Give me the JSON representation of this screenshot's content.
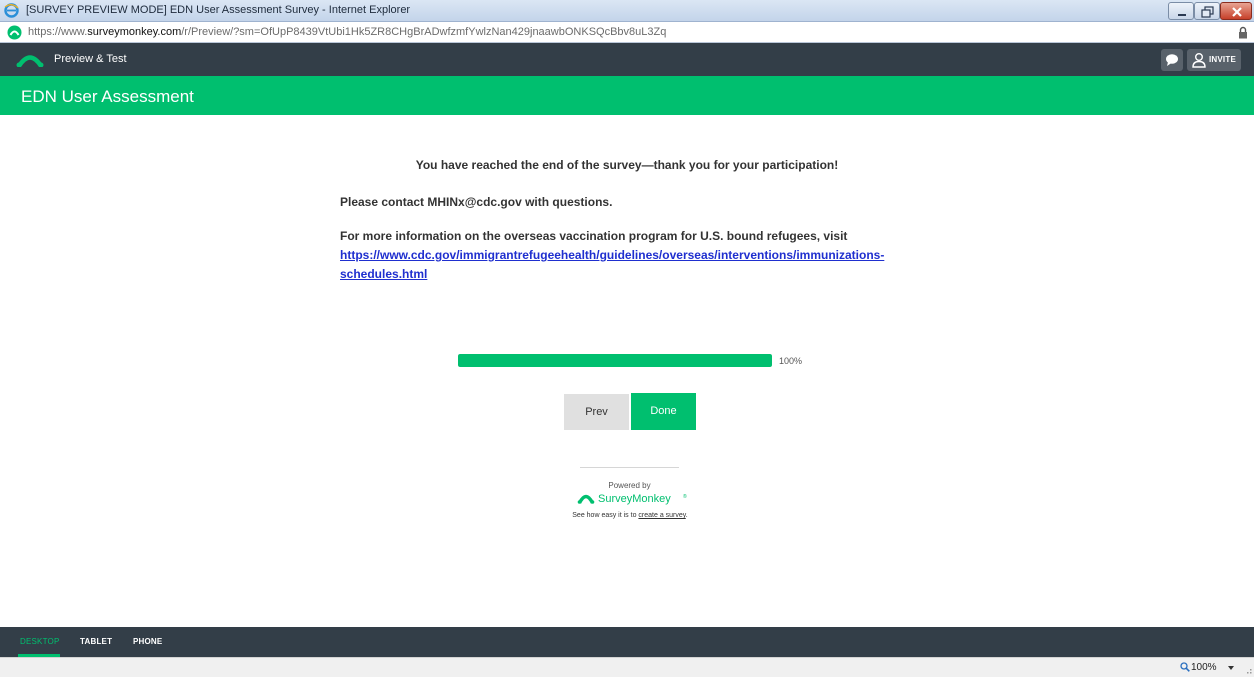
{
  "window": {
    "title": "[SURVEY PREVIEW MODE] EDN User Assessment Survey - Internet Explorer",
    "url_scheme": "https://www.",
    "url_host": "surveymonkey.com",
    "url_path": "/r/Preview/?sm=OfUpP8439VtUbi1Hk5ZR8CHgBrADwfzmfYwlzNan429jnaawbONKSQcBbv8uL3Zq"
  },
  "app_header": {
    "label": "Preview & Test",
    "invite_label": "INVITE"
  },
  "survey": {
    "title": "EDN User Assessment"
  },
  "content": {
    "thanks": "You have reached the end of the survey—thank you for your participation!",
    "contact": "Please contact MHINx@cdc.gov with questions.",
    "info": "For more information on the overseas vaccination program for U.S. bound refugees, visit",
    "link_line1": "https://www.cdc.gov/immigrantrefugeehealth/guidelines/overseas/interventions/immunizations-",
    "link_line2": "schedules.html"
  },
  "progress": {
    "value": 100,
    "label": "100%"
  },
  "nav": {
    "prev_label": "Prev",
    "done_label": "Done"
  },
  "footer": {
    "powered_by": "Powered by",
    "brand": "SurveyMonkey",
    "brand_tm": "®",
    "tagline_prefix": "See how easy it is to ",
    "tagline_link": "create a survey",
    "tagline_suffix": "."
  },
  "device_tabs": {
    "desktop": "DESKTOP",
    "tablet": "TABLET",
    "phone": "PHONE",
    "selected": "desktop"
  },
  "statusbar": {
    "zoom": "100%"
  },
  "colors": {
    "brand_green": "#00bf6f",
    "header_dark": "#333e48",
    "link_blue": "#1f2fcf"
  },
  "icons": [
    "ie-logo-icon",
    "surveymonkey-icon",
    "lock-icon",
    "comment-icon",
    "person-icon",
    "zoom-icon",
    "chevron-down-icon"
  ]
}
